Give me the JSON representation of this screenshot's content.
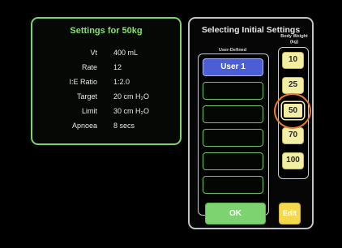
{
  "settings_panel": {
    "title": "Settings for 50kg",
    "rows": [
      {
        "label": "Vt",
        "value": "400 mL"
      },
      {
        "label": "Rate",
        "value": "12"
      },
      {
        "label": "I:E Ratio",
        "value": "1:2.0"
      },
      {
        "label": "Target",
        "value": "20 cm H₂O"
      },
      {
        "label": "Limit",
        "value": "30 cm H₂O"
      },
      {
        "label": "Apnoea",
        "value": "8 secs"
      }
    ]
  },
  "select_panel": {
    "title": "Selecting Initial Settings",
    "user_defined_header": "User-Defined",
    "body_weight_header_line1": "Body Weight",
    "body_weight_header_line2": "(kg)",
    "user_slots": [
      {
        "label": "User 1",
        "selected": true
      },
      {
        "label": "",
        "selected": false
      },
      {
        "label": "",
        "selected": false
      },
      {
        "label": "",
        "selected": false
      },
      {
        "label": "",
        "selected": false
      },
      {
        "label": "",
        "selected": false
      }
    ],
    "body_weights": [
      {
        "label": "10",
        "selected": false
      },
      {
        "label": "25",
        "selected": false
      },
      {
        "label": "50",
        "selected": true
      },
      {
        "label": "70",
        "selected": false
      },
      {
        "label": "100",
        "selected": false
      }
    ],
    "ok_label": "OK",
    "edit_label": "Edit"
  },
  "colors": {
    "settings_border": "#7fd36b",
    "selected_user": "#4b5ed6",
    "body_weight_button": "#f2eea3",
    "ok_button": "#7ed371",
    "edit_button": "#f4d94d",
    "highlight_ring": "#ef7b2b"
  }
}
